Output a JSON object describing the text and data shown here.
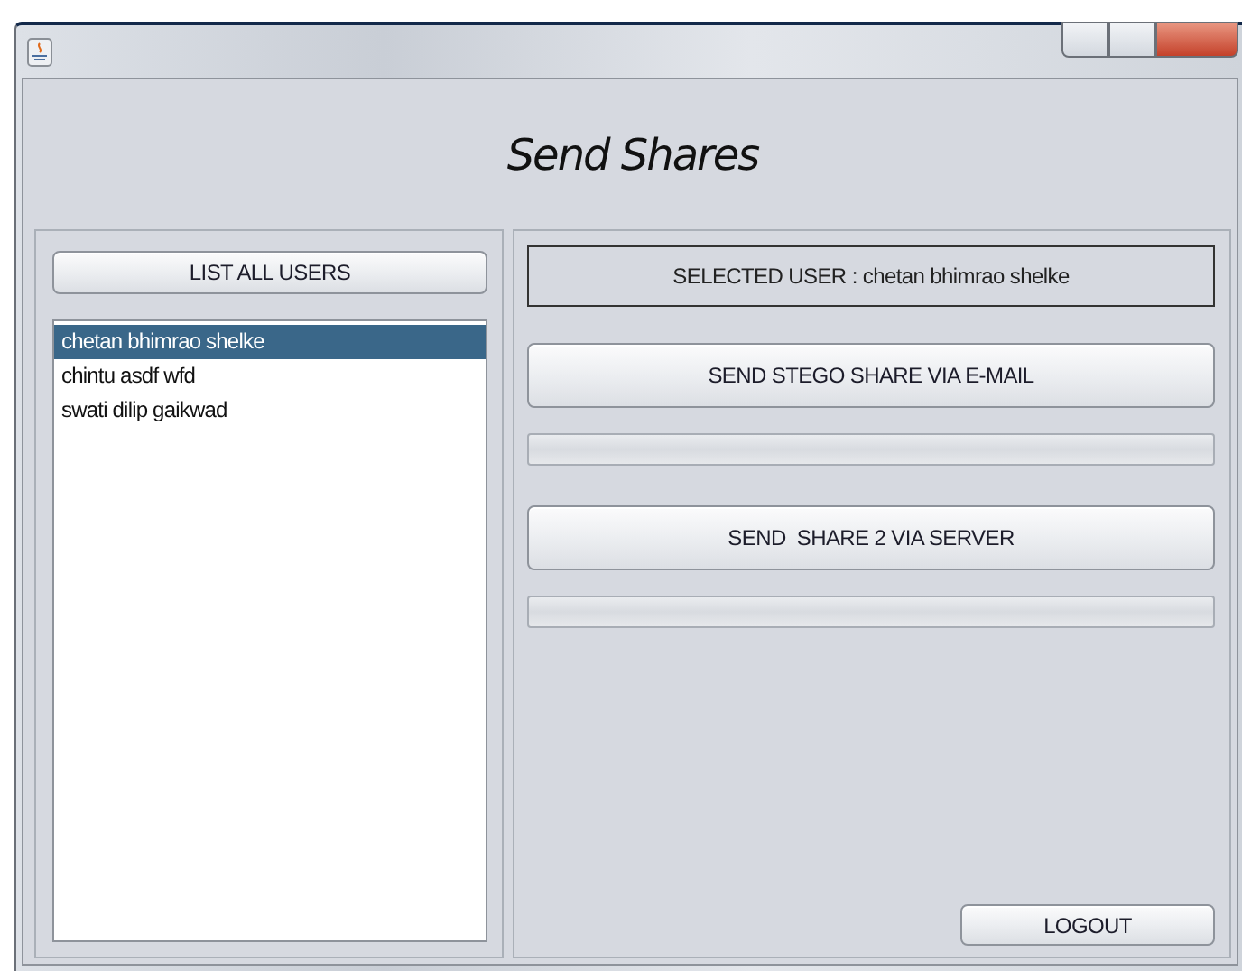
{
  "window": {
    "title": "Send Shares"
  },
  "list_button": "LIST ALL USERS",
  "users": [
    {
      "name": "chetan bhimrao shelke",
      "selected": true
    },
    {
      "name": "chintu asdf wfd",
      "selected": false
    },
    {
      "name": "swati dilip gaikwad",
      "selected": false
    }
  ],
  "selected_user_label": "SELECTED USER : chetan bhimrao shelke",
  "actions": [
    {
      "label": "SEND STEGO SHARE VIA E-MAIL",
      "level": 0
    },
    {
      "label": "SEND  SHARE 2 VIA SERVER",
      "level": 0
    }
  ],
  "logout_button": "LOGOUT"
}
